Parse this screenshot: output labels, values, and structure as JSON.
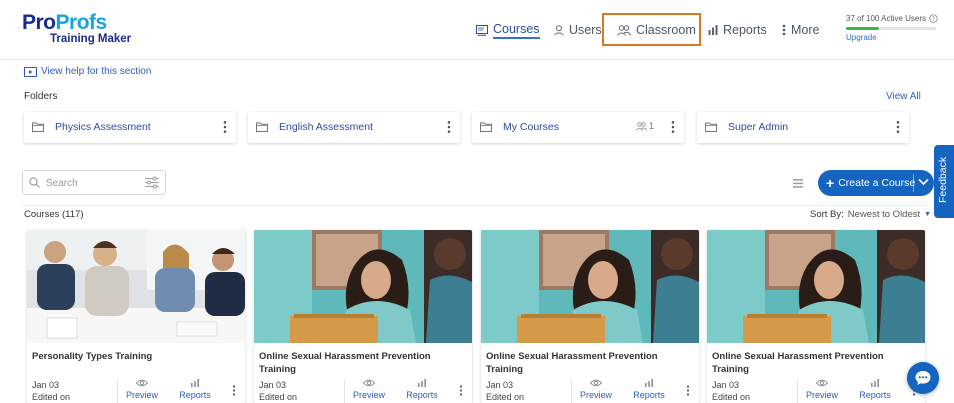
{
  "brand": {
    "logo_pro": "Pro",
    "logo_profs": "Profs",
    "logo_sub": "Training Maker"
  },
  "nav": {
    "courses": "Courses",
    "users": "Users",
    "classroom": "Classroom",
    "reports": "Reports",
    "more": "More"
  },
  "active_users": {
    "text": "37 of 100 Active Users",
    "used": 37,
    "total": 100,
    "upgrade": "Upgrade"
  },
  "help_link": "View help for this section",
  "folders": {
    "title": "Folders",
    "view_all": "View All",
    "items": [
      {
        "name": "Physics Assessment",
        "count": ""
      },
      {
        "name": "English Assessment",
        "count": ""
      },
      {
        "name": "My Courses",
        "count": "1"
      },
      {
        "name": "Super Admin",
        "count": ""
      }
    ]
  },
  "search": {
    "placeholder": "Search"
  },
  "create_button": "Create a Course",
  "feedback": "Feedback",
  "courses_header": {
    "count_label": "Courses (117)",
    "sort_label": "Sort By:",
    "sort_value": "Newest to Oldest"
  },
  "courses": [
    {
      "title": "Personality Types Training",
      "date": "Jan 03",
      "edited": "Edited on",
      "preview": "Preview",
      "reports": "Reports",
      "image": "office-meeting-photo"
    },
    {
      "title": "Online Sexual Harassment Prevention Training",
      "date": "Jan 03",
      "edited": "Edited on",
      "preview": "Preview",
      "reports": "Reports",
      "image": "woman-laptop-photo"
    },
    {
      "title": "Online Sexual Harassment Prevention Training",
      "date": "Jan 03",
      "edited": "Edited on",
      "preview": "Preview",
      "reports": "Reports",
      "image": "woman-laptop-photo"
    },
    {
      "title": "Online Sexual Harassment Prevention Training",
      "date": "Jan 03",
      "edited": "Edited on",
      "preview": "Preview",
      "reports": "Reports",
      "image": "woman-laptop-photo"
    }
  ],
  "colors": {
    "primary": "#1565c0",
    "brand_dark": "#1b2a8c",
    "brand_light": "#17a5e0",
    "highlight": "#d87a1f",
    "progress": "#3bb54a"
  }
}
